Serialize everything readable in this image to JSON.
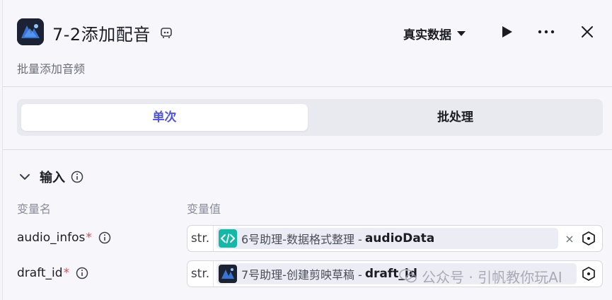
{
  "header": {
    "title": "7-2添加配音",
    "description": "批量添加音频",
    "mode_select": "真实数据",
    "icons": [
      "node-app-icon",
      "edit-icon",
      "play-icon",
      "more-icon",
      "close-icon"
    ]
  },
  "tabs": {
    "single": "单次",
    "batch": "批处理",
    "active": "single"
  },
  "input_section": {
    "title": "输入",
    "col_name": "变量名",
    "col_value": "变量值",
    "rows": [
      {
        "name": "audio_infos",
        "required": "*",
        "type": "str.",
        "ref_node": "6号助理-数据格式整理 -",
        "ref_var": "audioData",
        "clear": "×"
      },
      {
        "name": "draft_id",
        "required": "*",
        "type": "str.",
        "ref_node": "7号助理-创建剪映草稿 -",
        "ref_var": "draft_id"
      }
    ]
  },
  "watermark": {
    "text": "公众号 · 引帆教你玩AI"
  },
  "colors": {
    "accent": "#4d53e8",
    "code_icon_bg": "#14b8a6",
    "required": "#e5484d"
  }
}
